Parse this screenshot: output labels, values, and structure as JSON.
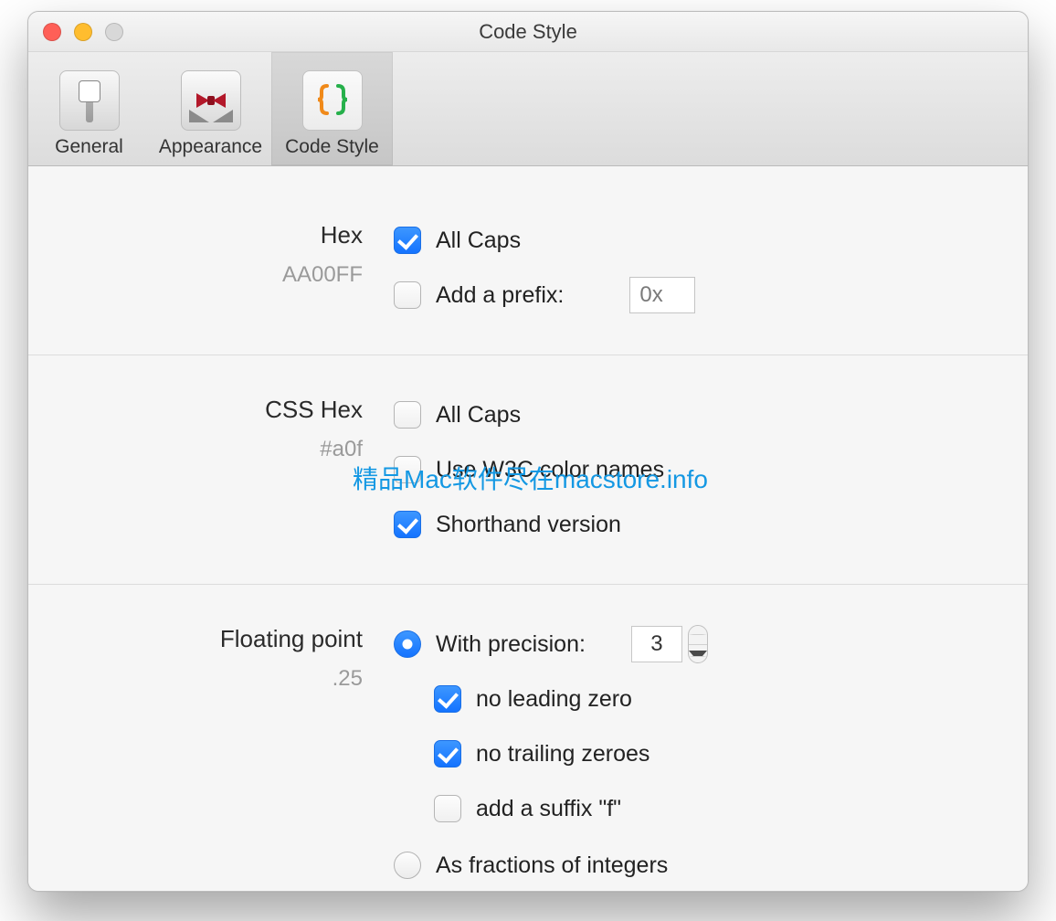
{
  "window": {
    "title": "Code Style"
  },
  "tabs": [
    {
      "label": "General"
    },
    {
      "label": "Appearance"
    },
    {
      "label": "Code Style"
    }
  ],
  "hex": {
    "heading": "Hex",
    "example": "AA00FF",
    "all_caps_label": "All Caps",
    "prefix_label": "Add a prefix:",
    "prefix_value": "0x"
  },
  "css_hex": {
    "heading": "CSS Hex",
    "example": "#a0f",
    "all_caps_label": "All Caps",
    "w3c_label": "Use W3C color names",
    "shorthand_label": "Shorthand version"
  },
  "float": {
    "heading": "Floating point",
    "example": ".25",
    "with_precision_label": "With precision:",
    "precision_value": "3",
    "no_leading_label": "no leading zero",
    "no_trailing_label": "no trailing zeroes",
    "suffix_label": "add a suffix \"f\"",
    "fractions_label": "As fractions of integers"
  },
  "watermark": "精品Mac软件尽在macstore.info"
}
